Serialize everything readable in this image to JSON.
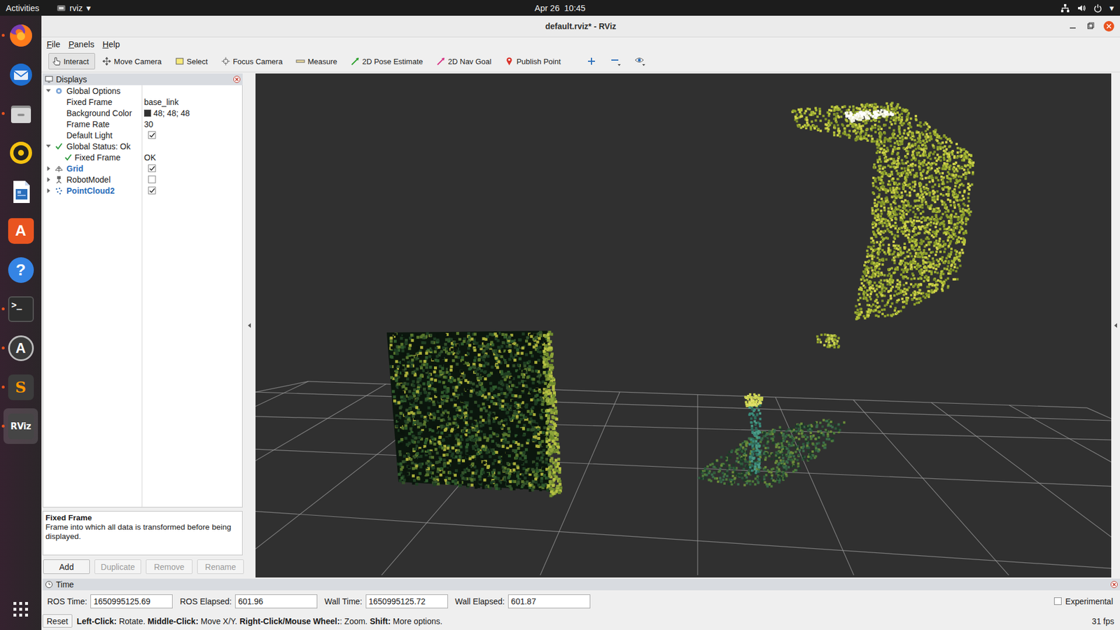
{
  "topbar": {
    "activities": "Activities",
    "app_name": "rviz",
    "app_arrow": "▾",
    "clock": "Apr 26  10:45",
    "system_arrow": "▾"
  },
  "dock": {
    "items": [
      {
        "kind": "firefox",
        "running": true,
        "selected": false
      },
      {
        "kind": "thunderbird",
        "running": false,
        "selected": false
      },
      {
        "kind": "files",
        "running": true,
        "selected": false
      },
      {
        "kind": "rhythmbox",
        "running": false,
        "selected": false
      },
      {
        "kind": "writer",
        "running": false,
        "selected": false
      },
      {
        "kind": "software",
        "glyph": "A",
        "running": false,
        "selected": false
      },
      {
        "kind": "help",
        "glyph": "?",
        "running": false,
        "selected": false
      },
      {
        "kind": "terminal",
        "glyph": ">_",
        "running": true,
        "selected": false
      },
      {
        "kind": "updater",
        "glyph": "A",
        "running": true,
        "selected": false
      },
      {
        "kind": "sublime",
        "glyph": "S",
        "running": true,
        "selected": false
      },
      {
        "kind": "rviz",
        "glyph": "RViz",
        "running": true,
        "selected": true
      }
    ]
  },
  "window": {
    "title": "default.rviz* - RViz"
  },
  "menubar": {
    "items": [
      {
        "label": "File"
      },
      {
        "label": "Panels"
      },
      {
        "label": "Help"
      }
    ]
  },
  "toolbar": {
    "tools": [
      {
        "kind": "interact",
        "label": "Interact",
        "selected": true
      },
      {
        "kind": "move",
        "label": "Move Camera",
        "selected": false
      },
      {
        "kind": "select",
        "label": "Select",
        "selected": false
      },
      {
        "kind": "focus",
        "label": "Focus Camera",
        "selected": false
      },
      {
        "kind": "measure",
        "label": "Measure",
        "selected": false
      },
      {
        "kind": "pose",
        "label": "2D Pose Estimate",
        "selected": false
      },
      {
        "kind": "goal",
        "label": "2D Nav Goal",
        "selected": false
      },
      {
        "kind": "point",
        "label": "Publish Point",
        "selected": false
      }
    ]
  },
  "displays": {
    "title": "Displays",
    "rows": [
      {
        "kind": "options",
        "label": "Global Options",
        "expanded": true
      },
      {
        "kind": "prop",
        "label": "Fixed Frame",
        "value": "base_link"
      },
      {
        "kind": "color",
        "label": "Background Color",
        "value": "48; 48; 48",
        "color": "#303030"
      },
      {
        "kind": "prop",
        "label": "Frame Rate",
        "value": "30"
      },
      {
        "kind": "bool",
        "label": "Default Light",
        "checked": true
      },
      {
        "kind": "status",
        "label": "Global Status: Ok",
        "expanded": true
      },
      {
        "kind": "statusitem",
        "label": "Fixed Frame",
        "value": "OK"
      },
      {
        "kind": "grid",
        "label": "Grid",
        "expanded": false,
        "checked": true
      },
      {
        "kind": "robotmodel",
        "label": "RobotModel",
        "expanded": false,
        "checked": false
      },
      {
        "kind": "pointcloud",
        "label": "PointCloud2",
        "expanded": false,
        "checked": true
      }
    ],
    "description": {
      "title": "Fixed Frame",
      "text": "Frame into which all data is transformed before being displayed."
    },
    "buttons": [
      {
        "label": "Add",
        "disabled": false
      },
      {
        "label": "Duplicate",
        "disabled": true
      },
      {
        "label": "Remove",
        "disabled": true
      },
      {
        "label": "Rename",
        "disabled": true
      }
    ]
  },
  "time_panel": {
    "title": "Time",
    "fields": [
      {
        "label": "ROS Time:",
        "value": "1650995125.69"
      },
      {
        "label": "ROS Elapsed:",
        "value": "601.96"
      },
      {
        "label": "Wall Time:",
        "value": "1650995125.72"
      },
      {
        "label": "Wall Elapsed:",
        "value": "601.87"
      }
    ],
    "experimental": {
      "label": "Experimental",
      "checked": false
    }
  },
  "status_bar": {
    "reset": "Reset",
    "hint": [
      {
        "text": "Left-Click:",
        "bold": true
      },
      {
        "text": " Rotate. ",
        "bold": false
      },
      {
        "text": "Middle-Click:",
        "bold": true
      },
      {
        "text": " Move X/Y. ",
        "bold": false
      },
      {
        "text": "Right-Click/Mouse Wheel:",
        "bold": true
      },
      {
        "text": ": Zoom. ",
        "bold": false
      },
      {
        "text": "Shift:",
        "bold": true
      },
      {
        "text": " More options.",
        "bold": false
      }
    ],
    "fps": "31 fps"
  }
}
